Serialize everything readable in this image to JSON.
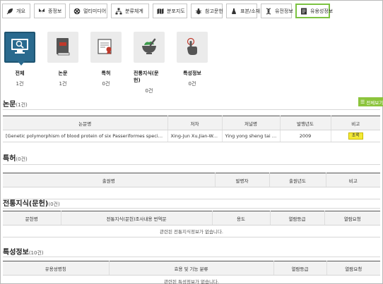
{
  "tabs": [
    {
      "label": "개요",
      "icon": "leaf-icon"
    },
    {
      "label": "종정보",
      "icon": "butterfly-icon"
    },
    {
      "label": "멀티미디어",
      "icon": "film-reel-icon"
    },
    {
      "label": "분류체계",
      "icon": "tree-hierarchy-icon"
    },
    {
      "label": "분포지도",
      "icon": "map-icon"
    },
    {
      "label": "참고문헌",
      "icon": "bug-icon"
    },
    {
      "label": "표본/소재",
      "icon": "specimen-icon"
    },
    {
      "label": "유전정보",
      "icon": "dna-icon"
    },
    {
      "label": "유용성정보",
      "icon": "document-list-icon"
    }
  ],
  "active_tab": "유용성정보",
  "categories": [
    {
      "name": "전체",
      "count": "1건",
      "icon": "monitor-search-icon"
    },
    {
      "name": "논문",
      "count": "1건",
      "icon": "book-icon"
    },
    {
      "name": "특허",
      "count": "0건",
      "icon": "certificate-icon"
    },
    {
      "name": "전통지식(문헌)",
      "count": "0건",
      "icon": "mortar-pestle-icon"
    },
    {
      "name": "특성정보",
      "count": "0건",
      "icon": "touch-hand-icon"
    }
  ],
  "papers": {
    "title": "논문",
    "count": "(1건)",
    "all_button": "전체보기",
    "columns": [
      "논문명",
      "저자",
      "저널명",
      "발행년도",
      "비고"
    ],
    "rows": [
      {
        "title": "[Genetic polymorphism of blood protein of six Passeriformes species in Zh…",
        "author": "Xing-Jun Xu,Jian-Wei …",
        "journal": "Ying yong sheng tai xu…",
        "year": "2009",
        "note": "초록"
      }
    ]
  },
  "patents": {
    "title": "특허",
    "count": "(0건)",
    "columns": [
      "출원명",
      "발명자",
      "출원년도",
      "비고"
    ]
  },
  "traditional": {
    "title": "전통지식(문헌)",
    "count": "(0건)",
    "columns": [
      "문헌명",
      "전통지식(문헌)조사내용 번역문",
      "용도",
      "열람등급",
      "열람요청"
    ],
    "empty": "관련된 전통지식정보가 없습니다."
  },
  "characteristics": {
    "title": "특성정보",
    "count": "(10건)",
    "columns": [
      "유용성명칭",
      "효용 및 기능 분류",
      "열람등급",
      "열람요청"
    ],
    "empty": "관련된 특성정보가 없습니다."
  },
  "colors": {
    "accent_green": "#8cc43c",
    "active_card": "#2a6a8e",
    "badge_yellow": "#f4ea35"
  }
}
